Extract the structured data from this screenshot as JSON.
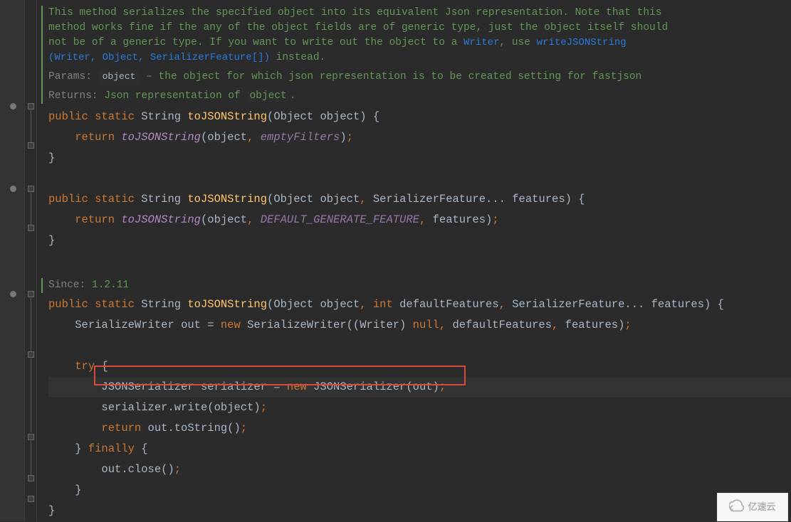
{
  "doc": {
    "description_line1": "This method serializes the specified object into its equivalent Json representation. Note that this",
    "description_line2": "method works fine if the any of the object fields are of generic type, just the object itself should",
    "description_line3": "not be of a generic type. If you want to write out the object to a ",
    "writer_link": "Writer",
    "use_txt": ", use ",
    "write_json_link": "writeJSONString",
    "sig_open": "(",
    "sig_writer": "Writer",
    "sig_object": "Object",
    "sig_serfeat": "SerializerFeature[]",
    "sig_close": ")",
    "instead": " instead.",
    "params_label": "Params:",
    "object_pill": "object",
    "params_desc": " – the object for which json representation is to be created setting for fastjson",
    "returns_label": "Returns:",
    "returns_desc_pre": " Json representation of ",
    "returns_obj": "object",
    "returns_dot": "."
  },
  "c": {
    "public": "public",
    "static": "static",
    "string": "String",
    "method": "toJSONString",
    "object_t": "Object",
    "object_p": "object",
    "return": "return",
    "call_tjs": "toJSONString",
    "emptyFilters": "emptyFilters",
    "serfeat": "SerializerFeature",
    "features": "features",
    "defgen": "DEFAULT_GENERATE_FEATURE",
    "since_label": "Since:",
    "since_ver": " 1.2.11",
    "int": "int",
    "deffeat": "defaultFeatures",
    "sw": "SerializeWriter",
    "out": "out",
    "eq": " = ",
    "new": "new",
    "writer": "Writer",
    "null": "null",
    "try": "try",
    "jsonser": "JSONSerializer",
    "serializer": "serializer",
    "write": ".write(",
    "tostring": ".toString()",
    "finally": "finally",
    "close": ".close()"
  },
  "wm": "亿速云"
}
